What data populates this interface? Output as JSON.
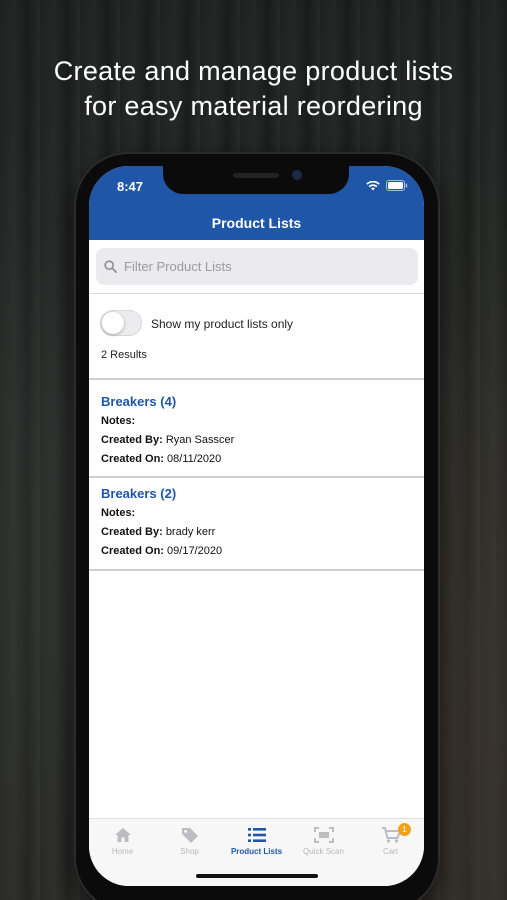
{
  "promo": {
    "headline_line1": "Create and manage product lists",
    "headline_line2": "for easy material reordering"
  },
  "status_bar": {
    "time": "8:47"
  },
  "header": {
    "title": "Product Lists"
  },
  "search": {
    "placeholder": "Filter Product Lists",
    "value": ""
  },
  "filter": {
    "toggle_label": "Show my product lists only",
    "toggle_on": false
  },
  "results_text": "2 Results",
  "lists": [
    {
      "title": "Breakers (4)",
      "notes_label": "Notes:",
      "notes_value": "",
      "created_by_label": "Created By:",
      "created_by": "Ryan Sasscer",
      "created_on_label": "Created On:",
      "created_on": "08/11/2020"
    },
    {
      "title": "Breakers (2)",
      "notes_label": "Notes:",
      "notes_value": "",
      "created_by_label": "Created By:",
      "created_by": "brady kerr",
      "created_on_label": "Created On:",
      "created_on": "09/17/2020"
    }
  ],
  "tabbar": {
    "tabs": [
      {
        "label": "Home",
        "icon": "home-icon"
      },
      {
        "label": "Shop",
        "icon": "tag-icon"
      },
      {
        "label": "Product Lists",
        "icon": "list-icon",
        "active": true
      },
      {
        "label": "Quick Scan",
        "icon": "scan-icon"
      },
      {
        "label": "Cart",
        "icon": "cart-icon"
      }
    ],
    "cart_badge": "1"
  },
  "colors": {
    "brand_blue": "#1f56a8",
    "badge_orange": "#f0a31a"
  }
}
